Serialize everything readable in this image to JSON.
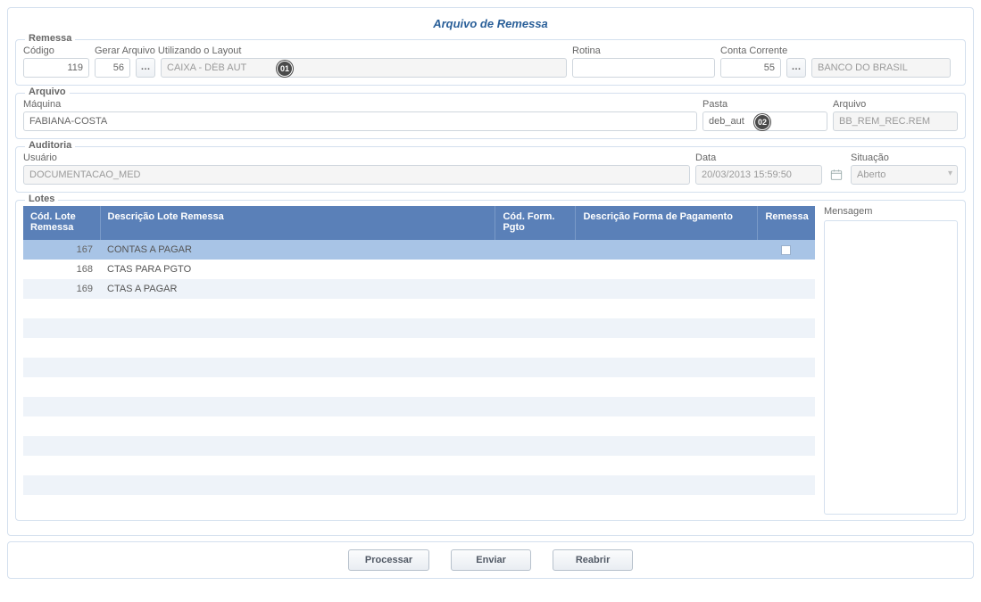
{
  "page": {
    "title": "Arquivo de Remessa"
  },
  "remessa": {
    "legend": "Remessa",
    "codigo_label": "Código",
    "codigo": "119",
    "layout_label": "Gerar Arquivo Utilizando o Layout",
    "layout_code": "56",
    "layout_desc": "CAIXA - DÉB AUT",
    "marker1": "01",
    "rotina_label": "Rotina",
    "rotina": "",
    "conta_label": "Conta Corrente",
    "conta": "55",
    "banco": "BANCO DO BRASIL"
  },
  "arquivo": {
    "legend": "Arquivo",
    "maquina_label": "Máquina",
    "maquina": "FABIANA-COSTA",
    "pasta_label": "Pasta",
    "pasta": "deb_aut",
    "marker2": "02",
    "arquivo_label": "Arquivo",
    "arquivo": "BB_REM_REC.REM"
  },
  "auditoria": {
    "legend": "Auditoria",
    "usuario_label": "Usuário",
    "usuario": "DOCUMENTACAO_MED",
    "data_label": "Data",
    "data": "20/03/2013 15:59:50",
    "situacao_label": "Situação",
    "situacao": "Aberto"
  },
  "lotes": {
    "legend": "Lotes",
    "mensagem_label": "Mensagem",
    "columns": {
      "cod": "Cód. Lote Remessa",
      "desc": "Descrição Lote Remessa",
      "codform": "Cód. Form. Pgto",
      "descform": "Descrição Forma de Pagamento",
      "remessa": "Remessa"
    },
    "rows": [
      {
        "cod": "167",
        "desc": "CONTAS A PAGAR",
        "codform": "",
        "descform": "",
        "remessa_checked": false,
        "selected": true
      },
      {
        "cod": "168",
        "desc": "CTAS PARA PGTO",
        "codform": "",
        "descform": "",
        "remessa_checked": false,
        "selected": false
      },
      {
        "cod": "169",
        "desc": "CTAS A PAGAR",
        "codform": "",
        "descform": "",
        "remessa_checked": false,
        "selected": false
      }
    ]
  },
  "buttons": {
    "processar": "Processar",
    "enviar": "Enviar",
    "reabrir": "Reabrir"
  },
  "icons": {
    "ellipsis": "…"
  }
}
